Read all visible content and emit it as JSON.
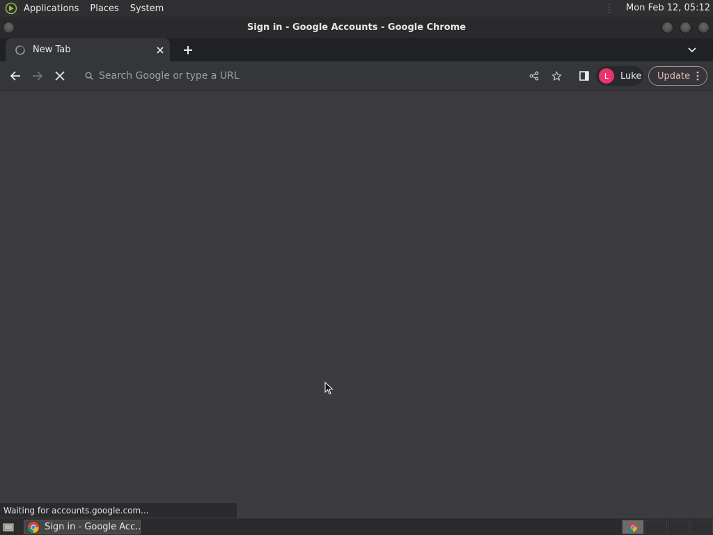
{
  "top_panel": {
    "menus": [
      "Applications",
      "Places",
      "System"
    ],
    "clock": "Mon Feb 12, 05:12"
  },
  "window": {
    "title": "Sign in - Google Accounts - Google Chrome"
  },
  "tabs": [
    {
      "title": "New Tab",
      "icon": "globe-loading-icon"
    }
  ],
  "toolbar": {
    "omnibox_placeholder": "Search Google or type a URL",
    "profile_initial": "L",
    "profile_name": "Luke",
    "update_label": "Update"
  },
  "status_bar": {
    "text": "Waiting for accounts.google.com..."
  },
  "taskbar": {
    "task_label": "Sign in - Google Acc..."
  },
  "colors": {
    "content_bg": "#3c3c40",
    "toolbar_bg": "#35363a",
    "tabstrip_bg": "#202124",
    "avatar": "#e8336d",
    "update_border": "#b18c8c"
  }
}
